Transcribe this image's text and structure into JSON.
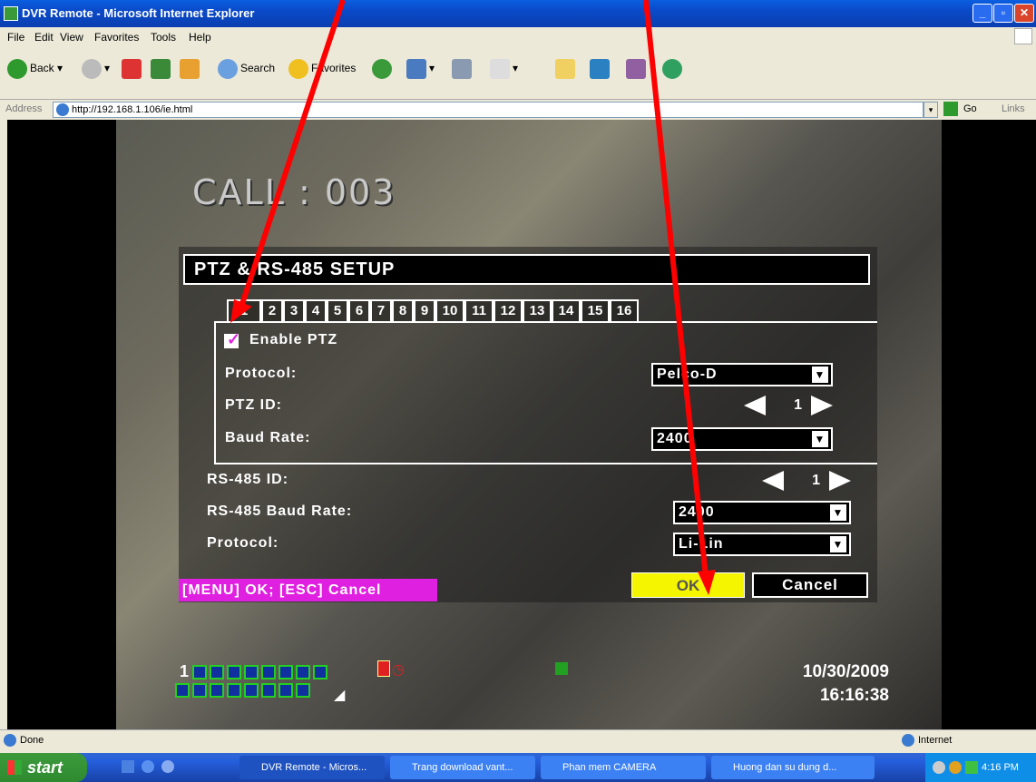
{
  "window": {
    "title": "DVR Remote - Microsoft Internet Explorer"
  },
  "menu": [
    "File",
    "Edit",
    "View",
    "Favorites",
    "Tools",
    "Help"
  ],
  "toolbar": {
    "back": "Back",
    "search": "Search",
    "favorites": "Favorites"
  },
  "address": {
    "label": "Address",
    "url": "http://192.168.1.106/ie.html",
    "go": "Go",
    "links": "Links"
  },
  "dvr": {
    "camera_label": "CALL : 003",
    "dialog_title": "PTZ & RS-485 SETUP",
    "tabs": [
      "1",
      "2",
      "3",
      "4",
      "5",
      "6",
      "7",
      "8",
      "9",
      "10",
      "11",
      "12",
      "13",
      "14",
      "15",
      "16"
    ],
    "enable_ptz": "Enable PTZ",
    "protocol_label": "Protocol:",
    "protocol_value": "Pelco-D",
    "ptz_id_label": "PTZ ID:",
    "ptz_id_value": "1",
    "baud_rate_label": "Baud Rate:",
    "baud_rate_value": "2400",
    "rs485_id_label": "RS-485 ID:",
    "rs485_id_value": "1",
    "rs485_baud_label": "RS-485 Baud Rate:",
    "rs485_baud_value": "2400",
    "rs485_protocol_label": "Protocol:",
    "rs485_protocol_value": "Li-Lin",
    "hint": "[MENU] OK; [ESC] Cancel",
    "ok": "OK",
    "cancel": "Cancel",
    "channel_label": "1",
    "date": "10/30/2009",
    "time": "16:16:38"
  },
  "status": {
    "left": "Done",
    "zone": "Internet"
  },
  "taskbar": {
    "start": "start",
    "tasks": [
      "DVR Remote - Micros...",
      "Trang download vant...",
      "Phan mem CAMERA",
      "Huong dan su dung d..."
    ],
    "clock": "4:16 PM"
  },
  "colors": {
    "ok_bg": "#f5f500",
    "hint_bg": "#e020e0",
    "arrow": "#ff0000"
  }
}
